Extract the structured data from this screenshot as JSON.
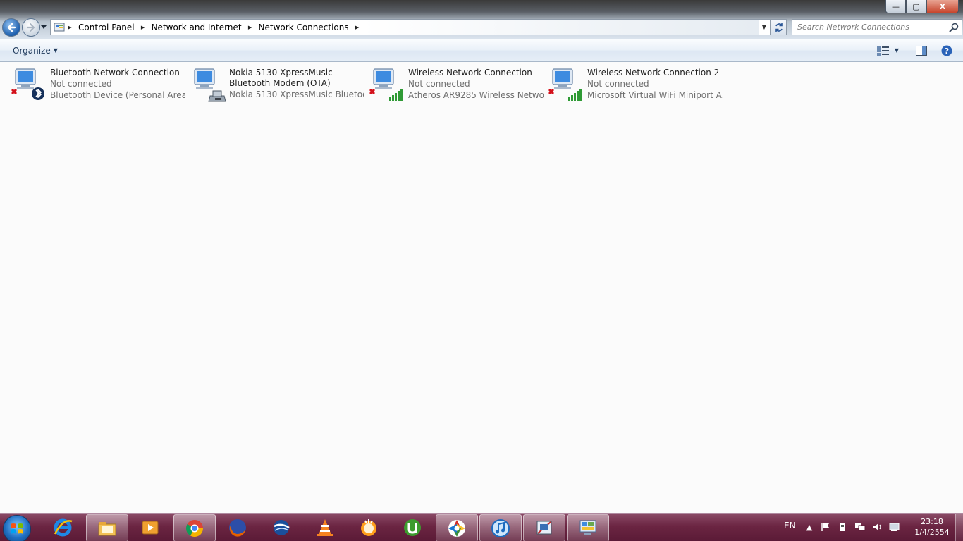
{
  "window": {
    "controls": {
      "minimize": "—",
      "maximize": "▢",
      "close": "X"
    }
  },
  "address": {
    "crumbs": [
      "Control Panel",
      "Network and Internet",
      "Network Connections"
    ]
  },
  "search": {
    "placeholder": "Search Network Connections"
  },
  "toolbar": {
    "organize_label": "Organize"
  },
  "connections": [
    {
      "name": "Bluetooth Network Connection",
      "status": "Not connected",
      "device": "Bluetooth Device (Personal Area ...",
      "icon": "network-adapter-icon",
      "badge": "bluetooth-icon",
      "disabled_mark": true
    },
    {
      "name": "Nokia 5130 XpressMusic Bluetooth Modem (OTA)",
      "status": "",
      "device": "Nokia 5130 XpressMusic Bluetoot...",
      "icon": "network-adapter-icon",
      "badge": "modem-icon",
      "disabled_mark": false
    },
    {
      "name": "Wireless Network Connection",
      "status": "Not connected",
      "device": "Atheros AR9285 Wireless Network...",
      "icon": "network-adapter-icon",
      "badge": "signal-bars-icon",
      "disabled_mark": true
    },
    {
      "name": "Wireless Network Connection 2",
      "status": "Not connected",
      "device": "Microsoft Virtual WiFi Miniport A...",
      "icon": "network-adapter-icon",
      "badge": "signal-bars-icon",
      "disabled_mark": true
    }
  ],
  "taskbar": {
    "apps": [
      "internet-explorer-icon",
      "windows-explorer-icon",
      "media-player-icon",
      "chrome-icon",
      "firefox-icon",
      "google-earth-icon",
      "vlc-icon",
      "jetaudio-icon",
      "utorrent-icon",
      "picasa-icon",
      "itunes-icon",
      "snipping-icon",
      "network-connections-icon"
    ],
    "language": "EN",
    "time": "23:18",
    "date": "1/4/2554"
  },
  "colors": {
    "taskbar": "#6b2542",
    "content_bg": "#fbfbfb",
    "status_text": "#6d6d6d",
    "link_text": "#1e395b",
    "disabled_x": "#d4111b"
  }
}
